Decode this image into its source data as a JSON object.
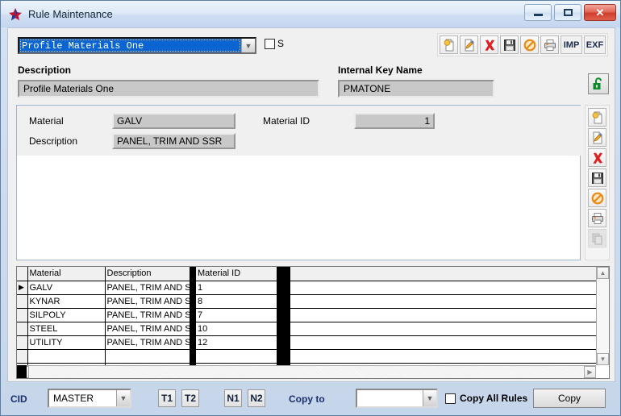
{
  "window": {
    "title": "Rule Maintenance",
    "icon": "star-icon",
    "controls": {
      "minimize": "–",
      "restore": "▫",
      "close": "✕"
    }
  },
  "rule_selector": {
    "value": "Profile Materials One",
    "s_checkbox_label": "S",
    "s_checked": false
  },
  "toolbar_top": {
    "buttons": [
      {
        "name": "new-record-button",
        "icon": "new-page-icon"
      },
      {
        "name": "edit-record-button",
        "icon": "edit-pencil-icon"
      },
      {
        "name": "delete-record-button",
        "icon": "red-x-icon"
      },
      {
        "name": "save-record-button",
        "icon": "floppy-disk-icon"
      },
      {
        "name": "cancel-record-button",
        "icon": "prohibited-icon"
      },
      {
        "name": "print-button",
        "icon": "printer-icon"
      }
    ],
    "import_label": "IMP",
    "export_label": "EXF"
  },
  "header_fields": {
    "description_label": "Description",
    "description_value": "Profile Materials One",
    "internal_key_label": "Internal Key Name",
    "internal_key_value": "PMATONE",
    "lock_icon": "green-unlock-icon"
  },
  "detail": {
    "material_label": "Material",
    "material_value": "GALV",
    "description_label": "Description",
    "description_value": "PANEL, TRIM AND SSR",
    "material_id_label": "Material ID",
    "material_id_value": "1"
  },
  "toolbar_right": {
    "buttons": [
      {
        "name": "new-detail-button",
        "icon": "new-page-icon",
        "disabled": false
      },
      {
        "name": "edit-detail-button",
        "icon": "edit-pencil-icon",
        "disabled": false
      },
      {
        "name": "delete-detail-button",
        "icon": "red-x-icon",
        "disabled": false
      },
      {
        "name": "save-detail-button",
        "icon": "floppy-disk-icon",
        "disabled": false
      },
      {
        "name": "cancel-detail-button",
        "icon": "prohibited-icon",
        "disabled": false
      },
      {
        "name": "print-detail-button",
        "icon": "printer-icon",
        "disabled": false
      },
      {
        "name": "copy-detail-button",
        "icon": "copy-icon",
        "disabled": true
      }
    ]
  },
  "grid": {
    "columns": [
      "Material",
      "Description",
      "Material ID"
    ],
    "rows": [
      {
        "selected": true,
        "material": "GALV",
        "description": "PANEL, TRIM AND S",
        "material_id": "1"
      },
      {
        "selected": false,
        "material": "KYNAR",
        "description": "PANEL, TRIM AND S",
        "material_id": "8"
      },
      {
        "selected": false,
        "material": "SILPOLY",
        "description": "PANEL, TRIM AND S",
        "material_id": "7"
      },
      {
        "selected": false,
        "material": "STEEL",
        "description": "PANEL, TRIM AND S",
        "material_id": "10"
      },
      {
        "selected": false,
        "material": "UTILITY",
        "description": "PANEL, TRIM AND S",
        "material_id": "12"
      },
      {
        "selected": false,
        "material": "",
        "description": "",
        "material_id": ""
      },
      {
        "selected": false,
        "material": "",
        "description": "",
        "material_id": ""
      }
    ],
    "row_marker": "▶"
  },
  "bottom_bar": {
    "cid_label": "CID",
    "cid_value": "MASTER",
    "t1_label": "T1",
    "t2_label": "T2",
    "n1_label": "N1",
    "n2_label": "N2",
    "copy_to_label": "Copy to",
    "copy_to_value": "",
    "copy_all_rules_label": "Copy All Rules",
    "copy_all_rules_checked": false,
    "copy_button_label": "Copy"
  },
  "colors": {
    "selection_blue": "#0a64d2",
    "title_blue": "#1a2f6b",
    "close_red": "#cf3e2c",
    "lock_green": "#0a8a2a",
    "field_gray": "#c8c8c8"
  }
}
